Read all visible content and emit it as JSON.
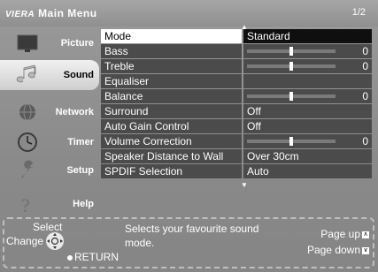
{
  "header": {
    "logo": "VIERA",
    "title": "Main Menu",
    "page": "1/2"
  },
  "sidebar": {
    "items": [
      {
        "label": "Picture",
        "active": false
      },
      {
        "label": "Sound",
        "active": true
      },
      {
        "label": "Network",
        "active": false
      },
      {
        "label": "Timer",
        "active": false
      },
      {
        "label": "Setup",
        "active": false
      },
      {
        "label": "Help",
        "active": false
      }
    ]
  },
  "menu": {
    "rows": [
      {
        "name": "Mode",
        "value": "Standard"
      },
      {
        "name": "Bass",
        "value": "0",
        "slider": 0.5
      },
      {
        "name": "Treble",
        "value": "0",
        "slider": 0.5
      },
      {
        "name": "Equaliser",
        "value": ""
      },
      {
        "name": "Balance",
        "value": "0",
        "slider": 0.5
      },
      {
        "name": "Surround",
        "value": "Off"
      },
      {
        "name": "Auto Gain Control",
        "value": "Off"
      },
      {
        "name": "Volume Correction",
        "value": "0",
        "slider": 0.5
      },
      {
        "name": "Speaker Distance to Wall",
        "value": "Over 30cm"
      },
      {
        "name": "SPDIF Selection",
        "value": "Auto"
      }
    ]
  },
  "help": {
    "select": "Select",
    "change": "Change",
    "return": "RETURN",
    "description": "Selects your favourite sound mode.",
    "page_up": "Page up",
    "page_down": "Page down"
  },
  "colors": {
    "selected_row": "#ffffff",
    "row_bg": "#4b4b4b"
  }
}
